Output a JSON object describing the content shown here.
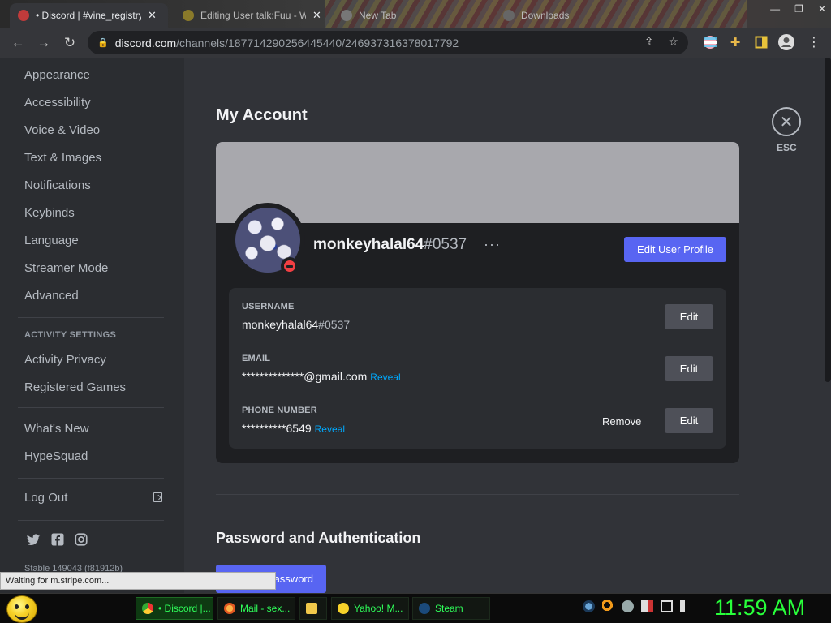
{
  "browser": {
    "tabs": [
      {
        "label": "• Discord | #vine_registry",
        "close": "✕",
        "active": true
      },
      {
        "label": "Editing User talk:Fuu - Wiki",
        "close": "✕",
        "active": false
      },
      {
        "label": "New Tab",
        "close": "",
        "active": false
      },
      {
        "label": "Downloads",
        "close": "",
        "active": false
      }
    ],
    "window_controls": {
      "minimize": "—",
      "maximize": "❐",
      "close": "✕"
    },
    "url_host": "discord.com",
    "url_path": "/channels/187714290256445440/246937316378017792"
  },
  "sidebar": {
    "items": [
      "Appearance",
      "Accessibility",
      "Voice & Video",
      "Text & Images",
      "Notifications",
      "Keybinds",
      "Language",
      "Streamer Mode",
      "Advanced"
    ],
    "activity_heading": "ACTIVITY SETTINGS",
    "activity_items": [
      "Activity Privacy",
      "Registered Games"
    ],
    "misc_items": [
      "What's New",
      "HypeSquad"
    ],
    "logout": "Log Out",
    "version": "Stable 149043 (f81912b)"
  },
  "account": {
    "title": "My Account",
    "esc_label": "ESC",
    "username": "monkeyhalal64",
    "discriminator": "#0537",
    "more": "···",
    "edit_profile": "Edit User Profile",
    "fields": {
      "username_label": "USERNAME",
      "username_value": "monkeyhalal64",
      "username_tag": "#0537",
      "email_label": "EMAIL",
      "email_value": "**************@gmail.com",
      "phone_label": "PHONE NUMBER",
      "phone_value": "**********6549",
      "reveal": "Reveal",
      "edit": "Edit",
      "remove": "Remove"
    },
    "password_section_title": "Password and Authentication",
    "change_password": "assword"
  },
  "statusbar": {
    "text": "Waiting for m.stripe.com..."
  },
  "taskbar": {
    "tasks": [
      "• Discord |...",
      "Mail - sex...",
      "",
      "Yahoo! M...",
      "Steam"
    ],
    "clock": "11:59 AM"
  },
  "colors": {
    "blurple": "#5865f2",
    "link": "#00a8fc",
    "dnd": "#f23f43",
    "clock": "#28ff3a"
  }
}
